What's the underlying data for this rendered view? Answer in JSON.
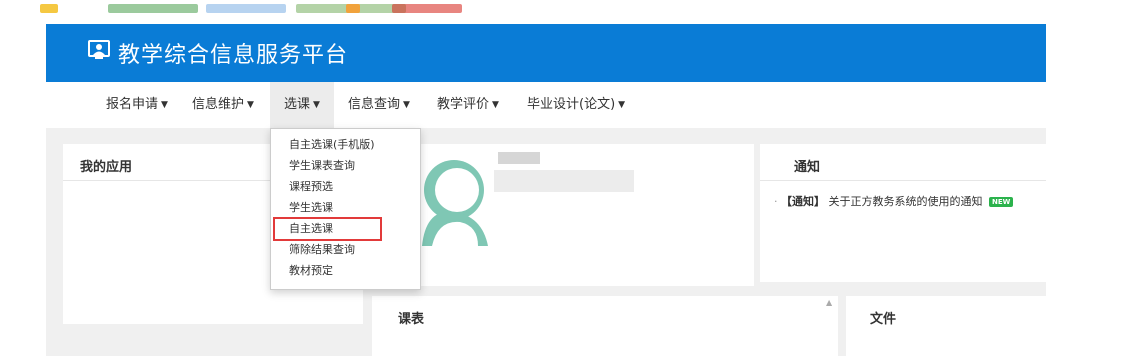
{
  "header": {
    "title": "教学综合信息服务平台",
    "logo_icon": "monitor-user-icon",
    "background": "#0a7cd6"
  },
  "nav": {
    "items": [
      {
        "label": "报名申请"
      },
      {
        "label": "信息维护"
      },
      {
        "label": "选课"
      },
      {
        "label": "信息查询"
      },
      {
        "label": "教学评价"
      },
      {
        "label": "毕业设计(论文)"
      }
    ],
    "active": "选课"
  },
  "dropdown": {
    "items": [
      {
        "label": "自主选课(手机版)"
      },
      {
        "label": "学生课表查询"
      },
      {
        "label": "课程预选"
      },
      {
        "label": "学生选课"
      },
      {
        "label": "自主选课"
      },
      {
        "label": "筛除结果查询"
      },
      {
        "label": "教材预定"
      }
    ],
    "highlighted": "自主选课",
    "highlight_color": "#e23a3a"
  },
  "panels": {
    "my_apps_title": "我的应用",
    "notice_title": "通知",
    "schedule_title": "课表",
    "files_title": "文件"
  },
  "notice": {
    "bullet": "·",
    "tag": "【通知】",
    "text": "关于正方教务系统的使用的通知",
    "badge": "NEW",
    "badge_color": "#2bb24c"
  }
}
